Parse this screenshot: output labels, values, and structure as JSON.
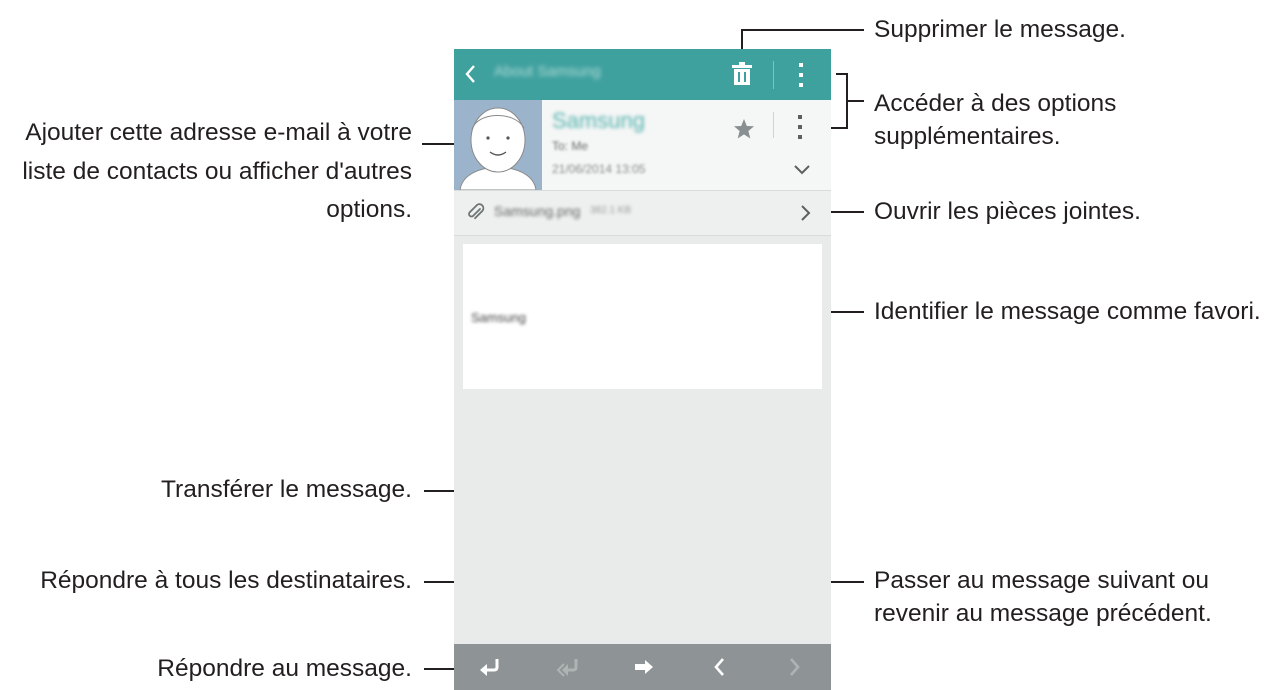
{
  "callouts": {
    "delete": "Supprimer le message.",
    "more_options_line1": "Accéder à des options",
    "more_options_line2": "supplémentaires.",
    "contact_line1": "Ajouter cette adresse e-mail à votre",
    "contact_line2": "liste de contacts ou afficher d'autres",
    "contact_line3": "options.",
    "attachments": "Ouvrir les pièces jointes.",
    "favorite": "Identifier le message comme favori.",
    "forward": "Transférer le message.",
    "reply_all": "Répondre à tous les destinataires.",
    "next_prev_line1": "Passer au message suivant ou",
    "next_prev_line2": "revenir au message précédent.",
    "reply": "Répondre au message."
  },
  "screen": {
    "appbar": {
      "title": "About Samsung",
      "color": "#3fa19e"
    },
    "message": {
      "sender": "Samsung",
      "recipient": "To: Me",
      "date": "21/06/2014 13:05"
    },
    "attachment": {
      "name": "Samsung.png",
      "size": "382.1 KB"
    },
    "body": {
      "text": "Samsung"
    },
    "bottombar": {
      "color": "#8e9495"
    }
  },
  "icons": [
    "back-icon",
    "trash-icon",
    "more-options-icon",
    "avatar-icon",
    "star-icon",
    "chevron-down-icon",
    "paperclip-icon",
    "chevron-right-icon",
    "reply-icon",
    "reply-all-icon",
    "forward-icon",
    "previous-icon",
    "next-icon"
  ]
}
